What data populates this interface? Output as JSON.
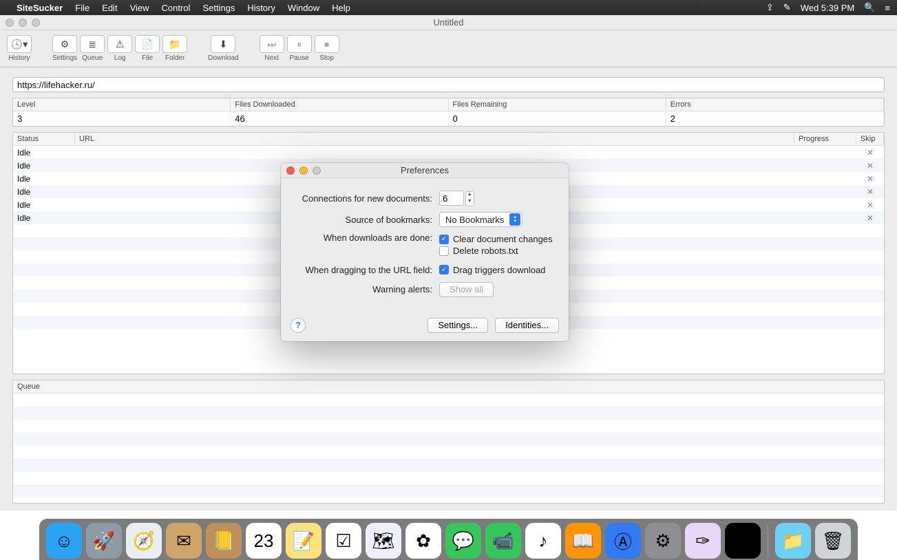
{
  "menubar": {
    "app": "SiteSucker",
    "items": [
      "File",
      "Edit",
      "View",
      "Control",
      "Settings",
      "History",
      "Window",
      "Help"
    ],
    "clock": "Wed 5:39 PM"
  },
  "window": {
    "title": "Untitled"
  },
  "toolbar": {
    "history": "History",
    "settings": "Settings",
    "queue": "Queue",
    "log": "Log",
    "file": "File",
    "folder": "Folder",
    "download": "Download",
    "next": "Next",
    "pause": "Pause",
    "stop": "Stop"
  },
  "url": "https://lifehacker.ru/",
  "stats": {
    "headers": {
      "level": "Level",
      "downloaded": "Files Downloaded",
      "remaining": "Files Remaining",
      "errors": "Errors"
    },
    "values": {
      "level": "3",
      "downloaded": "46",
      "remaining": "0",
      "errors": "2"
    }
  },
  "list": {
    "headers": {
      "status": "Status",
      "url": "URL",
      "progress": "Progress",
      "skip": "Skip"
    },
    "rows": [
      {
        "status": "Idle",
        "url": ""
      },
      {
        "status": "Idle",
        "url": ""
      },
      {
        "status": "Idle",
        "url": ""
      },
      {
        "status": "Idle",
        "url": ""
      },
      {
        "status": "Idle",
        "url": ""
      },
      {
        "status": "Idle",
        "url": ""
      }
    ]
  },
  "queue": {
    "header": "Queue"
  },
  "prefs": {
    "title": "Preferences",
    "connections_label": "Connections for new documents:",
    "connections_value": "6",
    "bookmarks_label": "Source of bookmarks:",
    "bookmarks_value": "No Bookmarks",
    "done_label": "When downloads are done:",
    "clear_label": "Clear document changes",
    "delete_label": "Delete robots.txt",
    "drag_label": "When dragging to the URL field:",
    "drag_triggers_label": "Drag triggers download",
    "warning_label": "Warning alerts:",
    "show_all": "Show all",
    "settings_btn": "Settings...",
    "identities_btn": "Identities..."
  },
  "dock": {
    "items": [
      {
        "name": "finder",
        "bg": "#2aa2f5",
        "glyph": "☺"
      },
      {
        "name": "launchpad",
        "bg": "#8e9aa5",
        "glyph": "🚀"
      },
      {
        "name": "safari",
        "bg": "#e9eef3",
        "glyph": "🧭"
      },
      {
        "name": "mail",
        "bg": "#cfa66a",
        "glyph": "✉"
      },
      {
        "name": "contacts",
        "bg": "#c09058",
        "glyph": "📒"
      },
      {
        "name": "calendar",
        "bg": "#fff",
        "glyph": "23"
      },
      {
        "name": "notes",
        "bg": "#ffe17a",
        "glyph": "📝"
      },
      {
        "name": "reminders",
        "bg": "#fff",
        "glyph": "☑"
      },
      {
        "name": "maps",
        "bg": "#eef",
        "glyph": "🗺"
      },
      {
        "name": "photos",
        "bg": "#fff",
        "glyph": "✿"
      },
      {
        "name": "messages",
        "bg": "#34c759",
        "glyph": "💬"
      },
      {
        "name": "facetime",
        "bg": "#34c759",
        "glyph": "📹"
      },
      {
        "name": "itunes",
        "bg": "#fff",
        "glyph": "♪"
      },
      {
        "name": "ibooks",
        "bg": "#ff9500",
        "glyph": "📖"
      },
      {
        "name": "appstore",
        "bg": "#2f7af6",
        "glyph": "Ⓐ"
      },
      {
        "name": "preferences",
        "bg": "#8e8e93",
        "glyph": "⚙"
      },
      {
        "name": "sitesucker",
        "bg": "#e8d7f7",
        "glyph": "✑"
      },
      {
        "name": "terminal",
        "bg": "#000",
        "glyph": "⌘"
      }
    ],
    "rightItems": [
      {
        "name": "downloads",
        "bg": "#6cd0f7",
        "glyph": "📁"
      },
      {
        "name": "trash",
        "bg": "#d0d3d8",
        "glyph": "🗑"
      }
    ]
  }
}
